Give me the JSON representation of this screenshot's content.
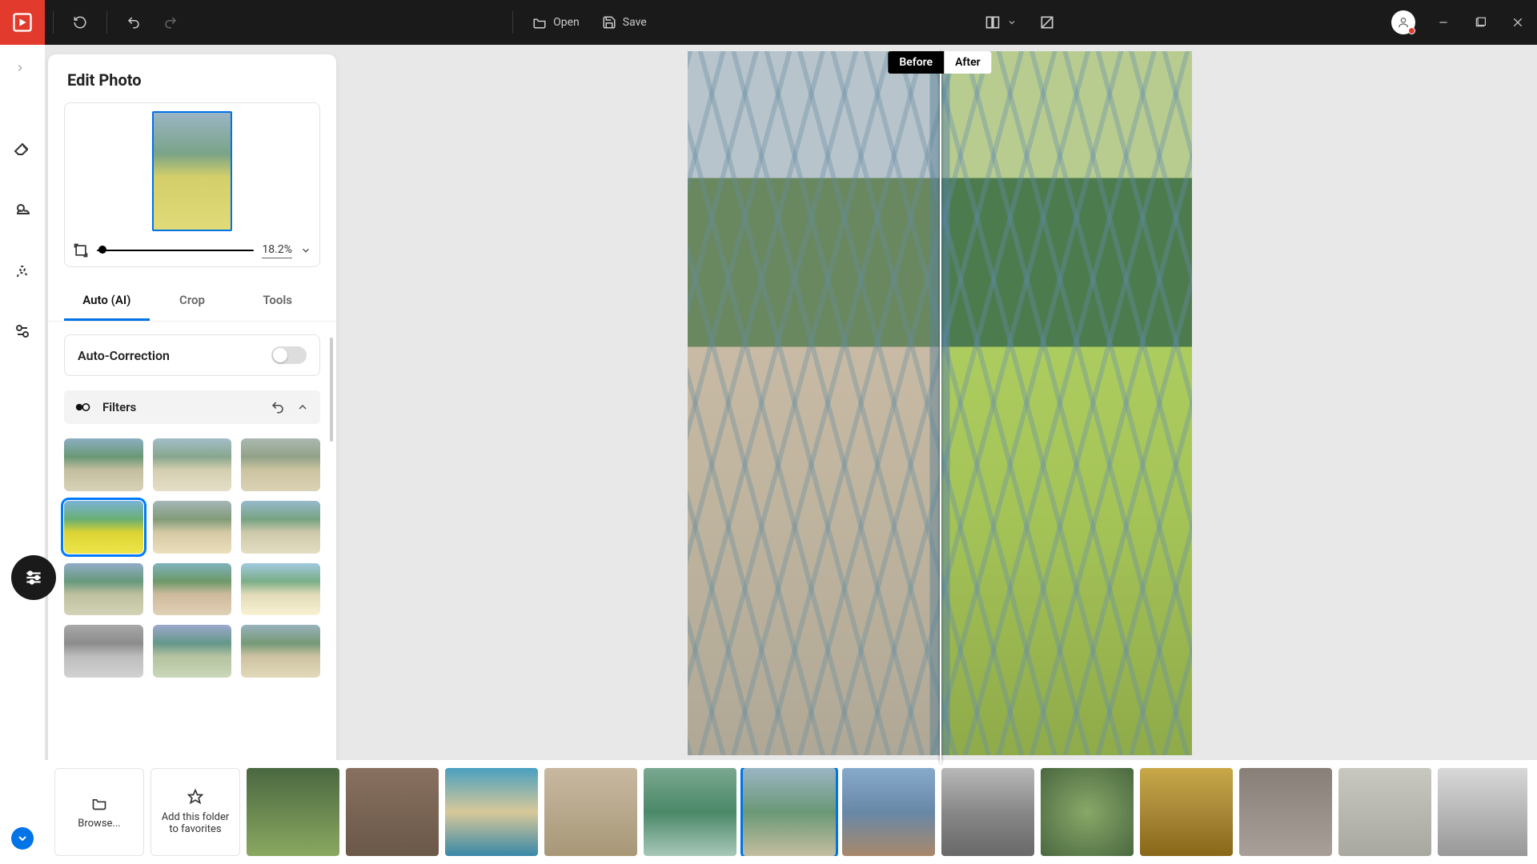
{
  "topbar": {
    "open_label": "Open",
    "save_label": "Save"
  },
  "panel": {
    "title": "Edit Photo",
    "zoom_value": "18.2%",
    "tabs": {
      "auto": "Auto (AI)",
      "crop": "Crop",
      "tools": "Tools"
    },
    "autocorrection_label": "Auto-Correction",
    "filters_label": "Filters"
  },
  "compare": {
    "before": "Before",
    "after": "After"
  },
  "strip": {
    "browse_label": "Browse...",
    "favorites_label": "Add this folder to favorites"
  }
}
